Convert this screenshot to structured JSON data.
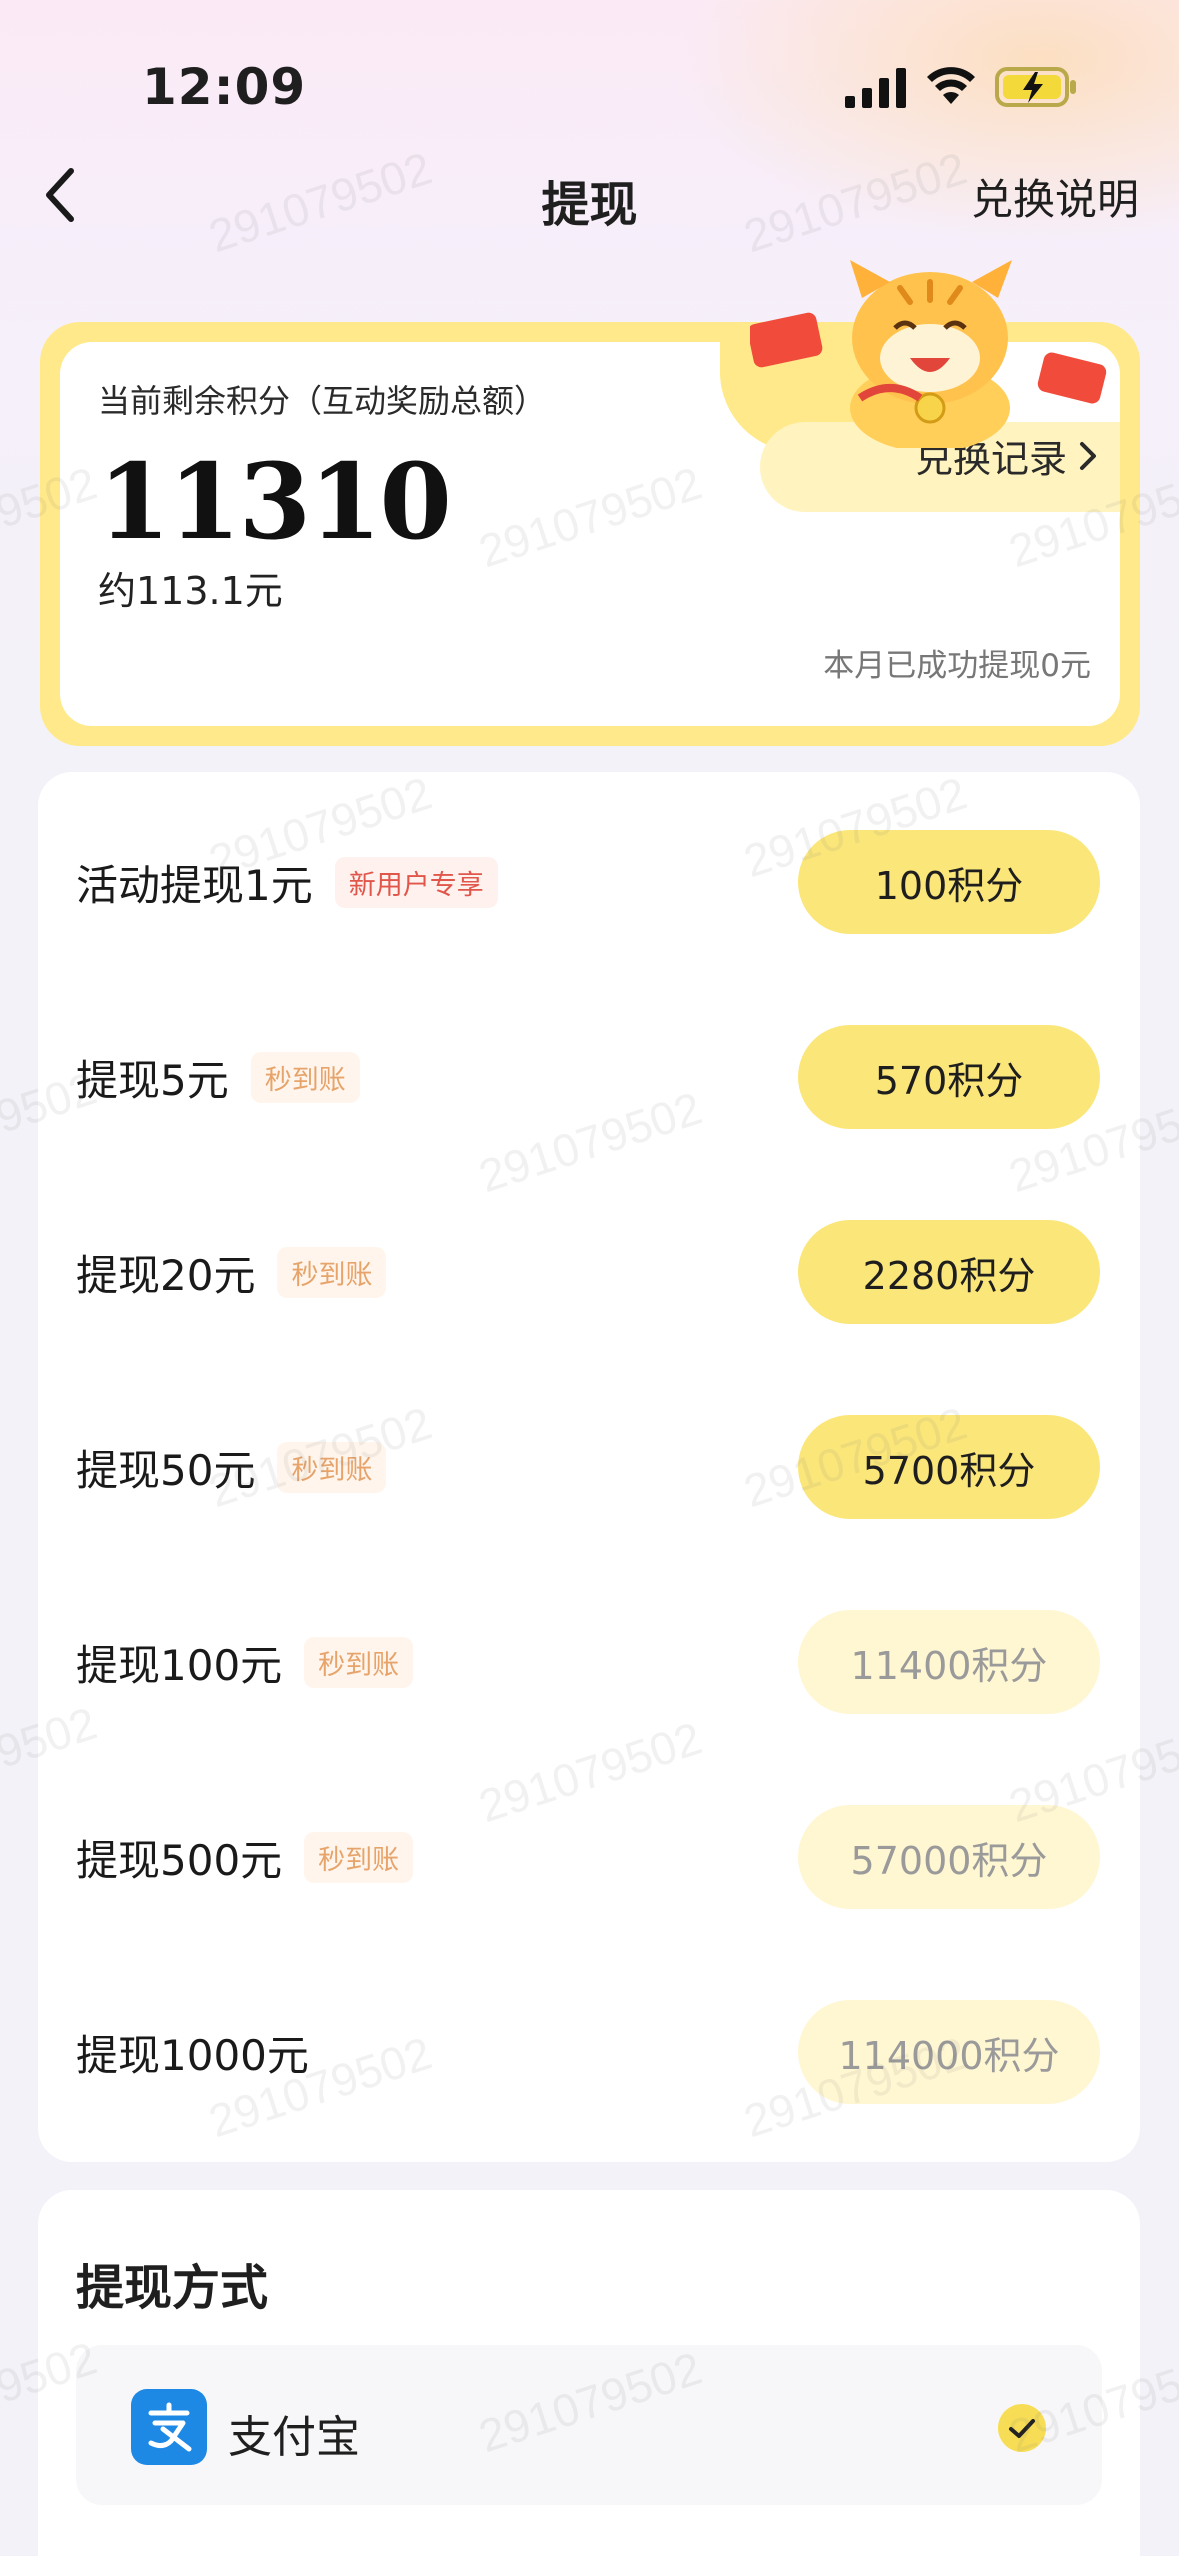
{
  "status_bar": {
    "time": "12:09"
  },
  "nav": {
    "title": "提现",
    "help_label": "兑换说明"
  },
  "points": {
    "label": "当前剩余积分（互动奖励总额）",
    "value": "11310",
    "rmb_equivalent": "约113.1元",
    "record_link": "兑换记录",
    "monthly_note": "本月已成功提现0元"
  },
  "options": [
    {
      "title": "活动提现1元",
      "tag": "新用户专享",
      "tag_style": "red",
      "button": "100积分",
      "enabled": true
    },
    {
      "title": "提现5元",
      "tag": "秒到账",
      "tag_style": "orange",
      "button": "570积分",
      "enabled": true
    },
    {
      "title": "提现20元",
      "tag": "秒到账",
      "tag_style": "orange",
      "button": "2280积分",
      "enabled": true
    },
    {
      "title": "提现50元",
      "tag": "秒到账",
      "tag_style": "orange",
      "button": "5700积分",
      "enabled": true
    },
    {
      "title": "提现100元",
      "tag": "秒到账",
      "tag_style": "orange",
      "button": "11400积分",
      "enabled": false
    },
    {
      "title": "提现500元",
      "tag": "秒到账",
      "tag_style": "orange",
      "button": "57000积分",
      "enabled": false
    },
    {
      "title": "提现1000元",
      "tag": "",
      "tag_style": "none",
      "button": "114000积分",
      "enabled": false
    }
  ],
  "method": {
    "title": "提现方式",
    "item_label": "支付宝",
    "icon": "alipay-icon",
    "selected": true
  },
  "watermark": "291079502",
  "colors": {
    "accent_yellow": "#fbe67a",
    "card_border": "#ffe98a",
    "tag_red": "#e0564b",
    "tag_orange": "#e6a46b"
  }
}
